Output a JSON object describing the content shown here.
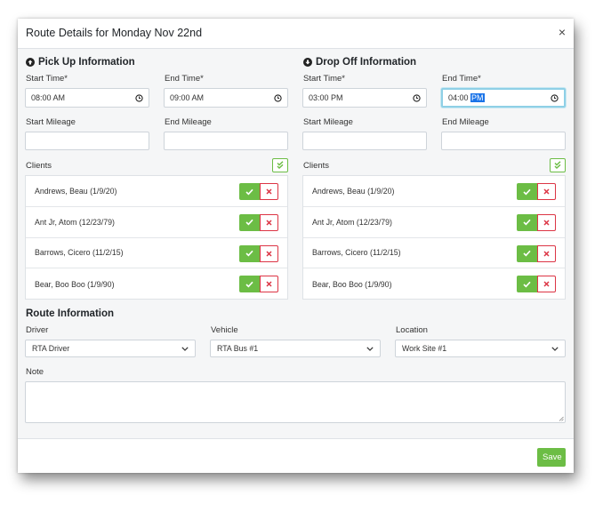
{
  "modal": {
    "title": "Route Details for Monday Nov 22nd",
    "close": "×"
  },
  "pickup": {
    "title": "Pick Up Information",
    "start_time_label": "Start Time*",
    "start_time": "08:00 AM",
    "end_time_label": "End Time*",
    "end_time": "09:00 AM",
    "start_mileage_label": "Start Mileage",
    "start_mileage": "",
    "end_mileage_label": "End Mileage",
    "end_mileage": "",
    "clients_label": "Clients",
    "clients": [
      "Andrews, Beau (1/9/20)",
      "Ant Jr, Atom (12/23/79)",
      "Barrows, Cicero (11/2/15)",
      "Bear, Boo Boo (1/9/90)"
    ]
  },
  "dropoff": {
    "title": "Drop Off Information",
    "start_time_label": "Start Time*",
    "start_time": "03:00 PM",
    "end_time_label": "End Time*",
    "end_time_prefix": "04:00 ",
    "end_time_selected": "PM",
    "start_mileage_label": "Start Mileage",
    "start_mileage": "",
    "end_mileage_label": "End Mileage",
    "end_mileage": "",
    "clients_label": "Clients",
    "clients": [
      "Andrews, Beau (1/9/20)",
      "Ant Jr, Atom (12/23/79)",
      "Barrows, Cicero (11/2/15)",
      "Bear, Boo Boo (1/9/90)"
    ]
  },
  "route": {
    "title": "Route Information",
    "driver_label": "Driver",
    "driver": "RTA Driver",
    "vehicle_label": "Vehicle",
    "vehicle": "RTA Bus #1",
    "location_label": "Location",
    "location": "Work Site #1",
    "note_label": "Note",
    "note": ""
  },
  "footer": {
    "save_label": "Save"
  },
  "colors": {
    "success": "#6cbd45",
    "danger": "#dc3545",
    "focus": "#8fd0e6",
    "selection": "#1a73e8"
  }
}
